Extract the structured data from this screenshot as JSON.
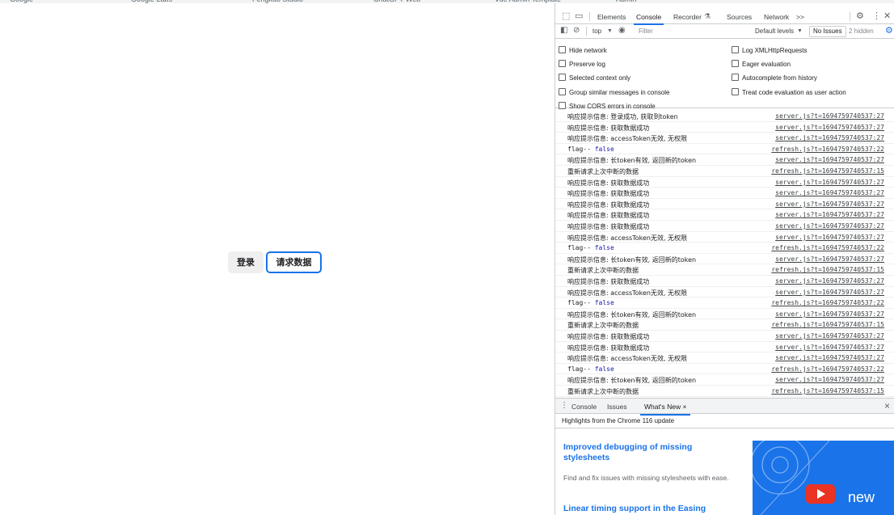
{
  "bookmarks": [
    "Google",
    "Google Labs",
    "Fengkuo Studio",
    "ChatGPT Web",
    "Vue Admin Template",
    "Admin"
  ],
  "page": {
    "login_label": "登录",
    "request_label": "请求数据"
  },
  "devtools": {
    "tabs": [
      "Elements",
      "Console",
      "Recorder",
      "Sources",
      "Network"
    ],
    "active_tab": "Console",
    "more_tabs": ">>",
    "context": "top",
    "filter_placeholder": "Filter",
    "levels": "Default levels",
    "no_issues": "No Issues",
    "hidden_count": "2 hidden",
    "settings_left": [
      "Hide network",
      "Preserve log",
      "Selected context only",
      "Group similar messages in console",
      "Show CORS errors in console"
    ],
    "settings_right": [
      "Log XMLHttpRequests",
      "Eager evaluation",
      "Autocomplete from history",
      "Treat code evaluation as user action"
    ],
    "log": [
      {
        "msg": "响应提示信息:  登录成功, 获取到token",
        "src": "server.js?t=1694759740537:27"
      },
      {
        "msg": "响应提示信息:  获取数据成功",
        "src": "server.js?t=1694759740537:27"
      },
      {
        "msg": "响应提示信息:  accessToken无效, 无权限",
        "src": "server.js?t=1694759740537:27"
      },
      {
        "msg": "flag-- ",
        "kw": "false",
        "src": "refresh.js?t=1694759740537:22"
      },
      {
        "msg": "响应提示信息:  长token有效, 返回新的token",
        "src": "server.js?t=1694759740537:27"
      },
      {
        "msg": "重新请求上次中断的数据",
        "src": "refresh.js?t=1694759740537:15"
      },
      {
        "msg": "响应提示信息:  获取数据成功",
        "src": "server.js?t=1694759740537:27"
      },
      {
        "msg": "响应提示信息:  获取数据成功",
        "src": "server.js?t=1694759740537:27"
      },
      {
        "msg": "响应提示信息:  获取数据成功",
        "src": "server.js?t=1694759740537:27"
      },
      {
        "msg": "响应提示信息:  获取数据成功",
        "src": "server.js?t=1694759740537:27"
      },
      {
        "msg": "响应提示信息:  获取数据成功",
        "src": "server.js?t=1694759740537:27"
      },
      {
        "msg": "响应提示信息:  accessToken无效, 无权限",
        "src": "server.js?t=1694759740537:27"
      },
      {
        "msg": "flag-- ",
        "kw": "false",
        "src": "refresh.js?t=1694759740537:22"
      },
      {
        "msg": "响应提示信息:  长token有效, 返回新的token",
        "src": "server.js?t=1694759740537:27"
      },
      {
        "msg": "重新请求上次中断的数据",
        "src": "refresh.js?t=1694759740537:15"
      },
      {
        "msg": "响应提示信息:  获取数据成功",
        "src": "server.js?t=1694759740537:27"
      },
      {
        "msg": "响应提示信息:  accessToken无效, 无权限",
        "src": "server.js?t=1694759740537:27"
      },
      {
        "msg": "flag-- ",
        "kw": "false",
        "src": "refresh.js?t=1694759740537:22"
      },
      {
        "msg": "响应提示信息:  长token有效, 返回新的token",
        "src": "server.js?t=1694759740537:27"
      },
      {
        "msg": "重新请求上次中断的数据",
        "src": "refresh.js?t=1694759740537:15"
      },
      {
        "msg": "响应提示信息:  获取数据成功",
        "src": "server.js?t=1694759740537:27"
      },
      {
        "msg": "响应提示信息:  获取数据成功",
        "src": "server.js?t=1694759740537:27"
      },
      {
        "msg": "响应提示信息:  accessToken无效, 无权限",
        "src": "server.js?t=1694759740537:27"
      },
      {
        "msg": "flag-- ",
        "kw": "false",
        "src": "refresh.js?t=1694759740537:22"
      },
      {
        "msg": "响应提示信息:  长token有效, 返回新的token",
        "src": "server.js?t=1694759740537:27"
      },
      {
        "msg": "重新请求上次中断的数据",
        "src": "refresh.js?t=1694759740537:15"
      }
    ],
    "drawer_tabs": [
      "Console",
      "Issues",
      "What's New"
    ],
    "drawer_active": "What's New",
    "whatsnew": {
      "header": "Highlights from the Chrome 116 update",
      "item1_title": "Improved debugging of missing stylesheets",
      "item1_text": "Find and fix issues with missing stylesheets with ease.",
      "item2_title": "Linear timing support in the Easing",
      "promo_text": "new"
    }
  }
}
